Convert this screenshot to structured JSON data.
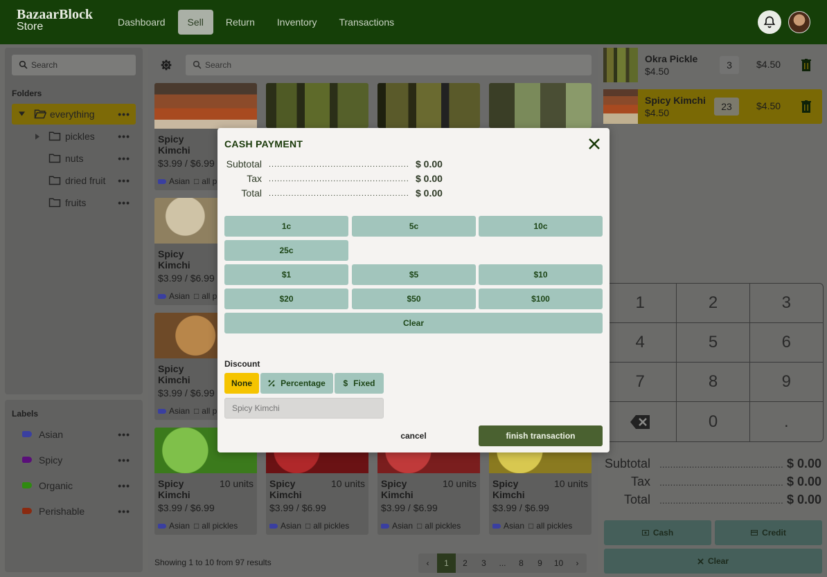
{
  "brand": {
    "line1": "BazaarBlock",
    "line2": "Store"
  },
  "nav": [
    {
      "label": "Dashboard"
    },
    {
      "label": "Sell",
      "active": true
    },
    {
      "label": "Return"
    },
    {
      "label": "Inventory"
    },
    {
      "label": "Transactions"
    }
  ],
  "sidebar": {
    "search_placeholder": "Search",
    "folders_title": "Folders",
    "folders": [
      {
        "label": "everything",
        "active": true
      },
      {
        "label": "pickles"
      },
      {
        "label": "nuts"
      },
      {
        "label": "dried fruit"
      },
      {
        "label": "fruits"
      }
    ],
    "labels_title": "Labels",
    "labels": [
      {
        "label": "Asian",
        "color": "#3a3fa0"
      },
      {
        "label": "Spicy",
        "color": "#5a0f7a"
      },
      {
        "label": "Organic",
        "color": "#2f8a10"
      },
      {
        "label": "Perishable",
        "color": "#8a2a10"
      }
    ]
  },
  "products": {
    "search_placeholder": "Search",
    "card": {
      "name": "Spicy Kimchi",
      "units": "10 units",
      "price": "$3.99 / $6.99",
      "label": "Asian",
      "folder": "all pickles"
    },
    "showing": "Showing 1 to 10 from 97 results",
    "pages": [
      "‹",
      "1",
      "2",
      "3",
      "...",
      "8",
      "9",
      "10",
      "›"
    ]
  },
  "cart": {
    "items": [
      {
        "name": "Okra Pickle",
        "price": "$4.50",
        "qty": "3",
        "total": "$4.50"
      },
      {
        "name": "Spicy Kimchi",
        "price": "$4.50",
        "qty": "23",
        "total": "$4.50"
      }
    ],
    "keys": [
      "1",
      "2",
      "3",
      "4",
      "5",
      "6",
      "7",
      "8",
      "9",
      "backspace",
      "0",
      "."
    ],
    "subtotal_label": "Subtotal",
    "tax_label": "Tax",
    "total_label": "Total",
    "subtotal": "$ 0.00",
    "tax": "$ 0.00",
    "total": "$ 0.00",
    "cash_label": "Cash",
    "credit_label": "Credit",
    "clear_label": "Clear"
  },
  "modal": {
    "title": "CASH PAYMENT",
    "subtotal_label": "Subtotal",
    "tax_label": "Tax",
    "total_label": "Total",
    "subtotal": "$ 0.00",
    "tax": "$ 0.00",
    "total": "$ 0.00",
    "dots": "..........................................................................",
    "coins": [
      "1c",
      "5c",
      "10c",
      "25c"
    ],
    "bills": [
      "$1",
      "$5",
      "$10",
      "$20",
      "$50",
      "$100"
    ],
    "clear_label": "Clear",
    "discount_label": "Discount",
    "discount_options": [
      "None",
      "Percentage",
      "Fixed"
    ],
    "discount_placeholder": "Spicy Kimchi",
    "cancel_label": "cancel",
    "finish_label": "finish transaction"
  },
  "colors": {
    "header": "#153f08",
    "accent": "#f5c400",
    "button": "#a2c5bc",
    "finish": "#4a6130"
  }
}
